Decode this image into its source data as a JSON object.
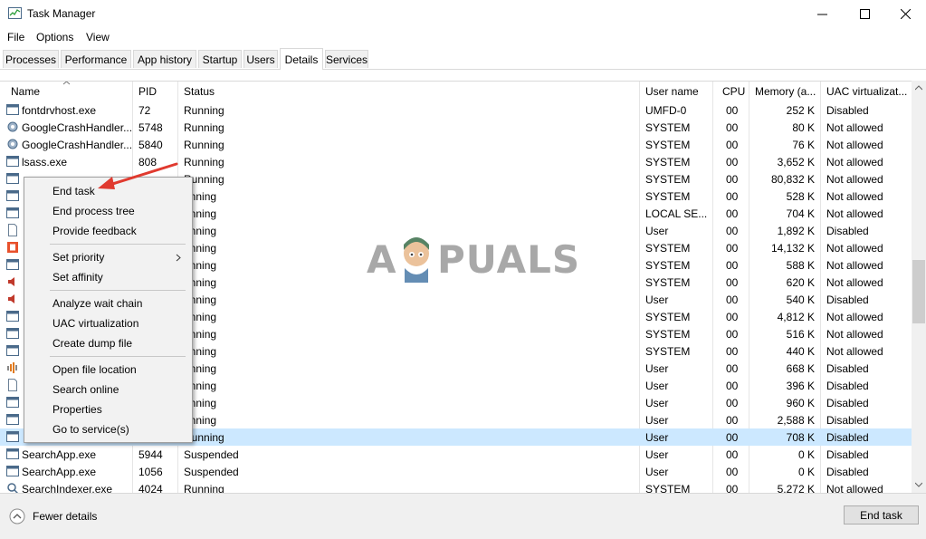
{
  "window": {
    "title": "Task Manager"
  },
  "menu": {
    "file": "File",
    "options": "Options",
    "view": "View"
  },
  "tabs": [
    {
      "label": "Processes"
    },
    {
      "label": "Performance"
    },
    {
      "label": "App history"
    },
    {
      "label": "Startup"
    },
    {
      "label": "Users"
    },
    {
      "label": "Details"
    },
    {
      "label": "Services"
    }
  ],
  "active_tab": "Details",
  "columns": {
    "name": "Name",
    "pid": "PID",
    "status": "Status",
    "user": "User name",
    "cpu": "CPU",
    "memory": "Memory (a...",
    "uac": "UAC virtualizat..."
  },
  "rows": [
    {
      "name": "fontdrvhost.exe",
      "pid": "72",
      "status": "Running",
      "user": "UMFD-0",
      "cpu": "00",
      "mem": "252 K",
      "uac": "Disabled",
      "icon": "window-icon"
    },
    {
      "name": "GoogleCrashHandler...",
      "pid": "5748",
      "status": "Running",
      "user": "SYSTEM",
      "cpu": "00",
      "mem": "80 K",
      "uac": "Not allowed",
      "icon": "gear-icon"
    },
    {
      "name": "GoogleCrashHandler...",
      "pid": "5840",
      "status": "Running",
      "user": "SYSTEM",
      "cpu": "00",
      "mem": "76 K",
      "uac": "Not allowed",
      "icon": "gear-icon"
    },
    {
      "name": "lsass.exe",
      "pid": "808",
      "status": "Running",
      "user": "SYSTEM",
      "cpu": "00",
      "mem": "3,652 K",
      "uac": "Not allowed",
      "icon": "window-icon"
    },
    {
      "name": "",
      "pid": "",
      "status": "Running",
      "user": "SYSTEM",
      "cpu": "00",
      "mem": "80,832 K",
      "uac": "Not allowed",
      "icon": "window-icon"
    },
    {
      "name": "",
      "pid": "",
      "status": "unning",
      "user": "SYSTEM",
      "cpu": "00",
      "mem": "528 K",
      "uac": "Not allowed",
      "icon": "window-icon"
    },
    {
      "name": "",
      "pid": "",
      "status": "unning",
      "user": "LOCAL SE...",
      "cpu": "00",
      "mem": "704 K",
      "uac": "Not allowed",
      "icon": "window-icon"
    },
    {
      "name": "",
      "pid": "",
      "status": "unning",
      "user": "User",
      "cpu": "00",
      "mem": "1,892 K",
      "uac": "Disabled",
      "icon": "document-icon"
    },
    {
      "name": "",
      "pid": "",
      "status": "unning",
      "user": "SYSTEM",
      "cpu": "00",
      "mem": "14,132 K",
      "uac": "Not allowed",
      "icon": "office-icon"
    },
    {
      "name": "",
      "pid": "",
      "status": "unning",
      "user": "SYSTEM",
      "cpu": "00",
      "mem": "588 K",
      "uac": "Not allowed",
      "icon": "window-icon"
    },
    {
      "name": "",
      "pid": "",
      "status": "unning",
      "user": "SYSTEM",
      "cpu": "00",
      "mem": "620 K",
      "uac": "Not allowed",
      "icon": "speaker-icon"
    },
    {
      "name": "",
      "pid": "",
      "status": "unning",
      "user": "User",
      "cpu": "00",
      "mem": "540 K",
      "uac": "Disabled",
      "icon": "speaker-icon"
    },
    {
      "name": "",
      "pid": "",
      "status": "unning",
      "user": "SYSTEM",
      "cpu": "00",
      "mem": "4,812 K",
      "uac": "Not allowed",
      "icon": "window-icon"
    },
    {
      "name": "",
      "pid": "",
      "status": "unning",
      "user": "SYSTEM",
      "cpu": "00",
      "mem": "516 K",
      "uac": "Not allowed",
      "icon": "window-icon"
    },
    {
      "name": "",
      "pid": "",
      "status": "unning",
      "user": "SYSTEM",
      "cpu": "00",
      "mem": "440 K",
      "uac": "Not allowed",
      "icon": "window-icon"
    },
    {
      "name": "",
      "pid": "",
      "status": "unning",
      "user": "User",
      "cpu": "00",
      "mem": "668 K",
      "uac": "Disabled",
      "icon": "audio-icon"
    },
    {
      "name": "",
      "pid": "",
      "status": "unning",
      "user": "User",
      "cpu": "00",
      "mem": "396 K",
      "uac": "Disabled",
      "icon": "document-icon"
    },
    {
      "name": "",
      "pid": "",
      "status": "unning",
      "user": "User",
      "cpu": "00",
      "mem": "960 K",
      "uac": "Disabled",
      "icon": "window-icon"
    },
    {
      "name": "",
      "pid": "",
      "status": "unning",
      "user": "User",
      "cpu": "00",
      "mem": "2,588 K",
      "uac": "Disabled",
      "icon": "window-icon"
    },
    {
      "name": "",
      "pid": "",
      "status": "Running",
      "user": "User",
      "cpu": "00",
      "mem": "708 K",
      "uac": "Disabled",
      "icon": "window-icon",
      "selected": true
    },
    {
      "name": "SearchApp.exe",
      "pid": "5944",
      "status": "Suspended",
      "user": "User",
      "cpu": "00",
      "mem": "0 K",
      "uac": "Disabled",
      "icon": "window-icon"
    },
    {
      "name": "SearchApp.exe",
      "pid": "1056",
      "status": "Suspended",
      "user": "User",
      "cpu": "00",
      "mem": "0 K",
      "uac": "Disabled",
      "icon": "window-icon"
    },
    {
      "name": "SearchIndexer.exe",
      "pid": "4024",
      "status": "Running",
      "user": "SYSTEM",
      "cpu": "00",
      "mem": "5,272 K",
      "uac": "Not allowed",
      "icon": "search-icon"
    }
  ],
  "context_menu": {
    "end_task": "End task",
    "end_tree": "End process tree",
    "feedback": "Provide feedback",
    "priority": "Set priority",
    "affinity": "Set affinity",
    "wait_chain": "Analyze wait chain",
    "uac": "UAC virtualization",
    "dump": "Create dump file",
    "open_location": "Open file location",
    "search_online": "Search online",
    "properties": "Properties",
    "go_service": "Go to service(s)"
  },
  "footer": {
    "fewer_details": "Fewer details",
    "end_task": "End task"
  },
  "watermark": {
    "text_a": "A",
    "text_b": "PUALS"
  },
  "colors": {
    "selection": "#cce8ff",
    "arrow": "#e03a2f"
  }
}
